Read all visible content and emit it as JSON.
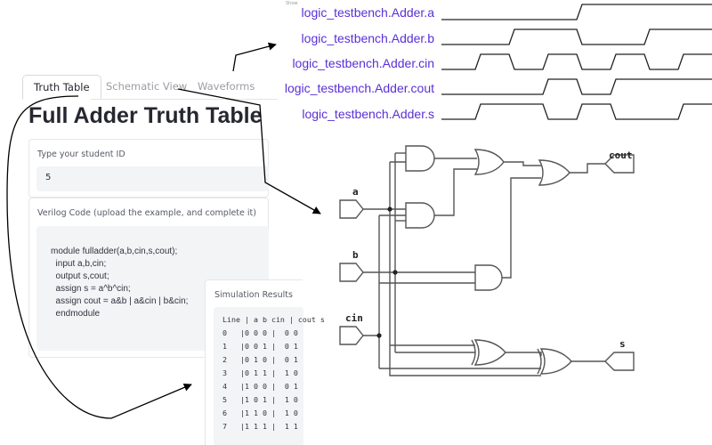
{
  "tabs": [
    {
      "label": "Truth Table",
      "active": true
    },
    {
      "label": "Schematic View",
      "active": false
    },
    {
      "label": "Waveforms",
      "active": false
    }
  ],
  "page_title": "Full Adder Truth Table",
  "student_id": {
    "label": "Type your student ID",
    "value": "5"
  },
  "verilog": {
    "label": "Verilog Code (upload the example, and complete it)",
    "lines": [
      "module fulladder(a,b,cin,s,cout);",
      "  input a,b,cin;",
      "  output s,cout;",
      "  assign s = a^b^cin;",
      "  assign cout = a&b | a&cin | b&cin;",
      "  endmodule"
    ]
  },
  "simulation": {
    "title": "Simulation Results",
    "header": "Line | a b cin | cout s",
    "rows": [
      "0   |0 0 0 |  0 0",
      "1   |0 0 1 |  0 1",
      "2   |0 1 0 |  0 1",
      "3   |0 1 1 |  1 0",
      "4   |1 0 0 |  0 1",
      "5   |1 0 1 |  1 0",
      "6   |1 1 0 |  1 0",
      "7   |1 1 1 |  1 1"
    ]
  },
  "waveforms": {
    "tiny_label": "Show",
    "signal_color": "#5a2fd6",
    "signals": [
      {
        "name": "logic_testbench.Adder.a",
        "levels": [
          0,
          0,
          0,
          0,
          1,
          1,
          1,
          1
        ]
      },
      {
        "name": "logic_testbench.Adder.b",
        "levels": [
          0,
          0,
          1,
          1,
          0,
          0,
          1,
          1
        ]
      },
      {
        "name": "logic_testbench.Adder.cin",
        "levels": [
          0,
          1,
          0,
          1,
          0,
          1,
          0,
          1
        ]
      },
      {
        "name": "logic_testbench.Adder.cout",
        "levels": [
          0,
          0,
          0,
          1,
          0,
          1,
          1,
          1
        ]
      },
      {
        "name": "logic_testbench.Adder.s",
        "levels": [
          0,
          1,
          1,
          0,
          1,
          0,
          0,
          1
        ]
      }
    ]
  },
  "schematic": {
    "inputs": [
      "a",
      "b",
      "cin"
    ],
    "outputs": [
      "cout",
      "s"
    ]
  }
}
